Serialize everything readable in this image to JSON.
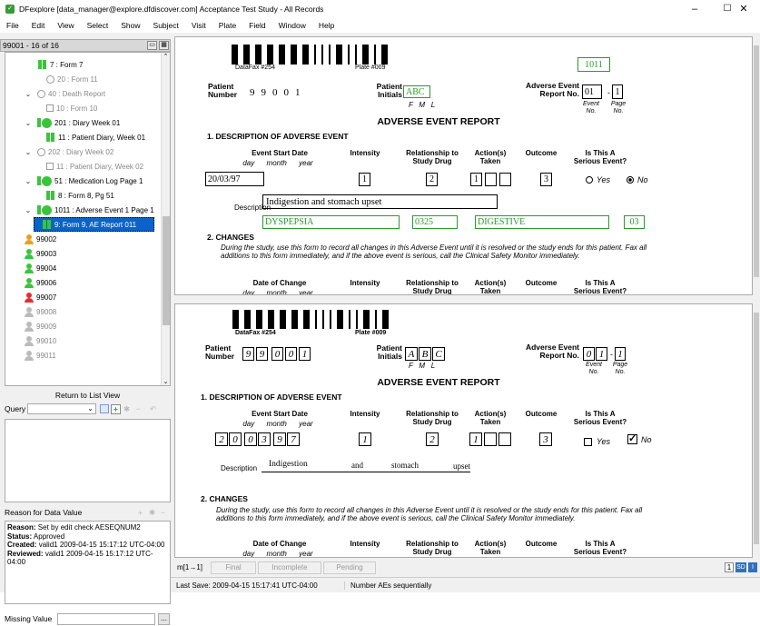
{
  "window": {
    "title": "DFexplore [data_manager@explore.dfdiscover.com] Acceptance Test Study - All Records",
    "minimize": "–",
    "maximize": "☐",
    "close": "✕"
  },
  "menu": [
    "File",
    "Edit",
    "View",
    "Select",
    "Show",
    "Subject",
    "Visit",
    "Plate",
    "Field",
    "Window",
    "Help"
  ],
  "left": {
    "header": "99001 - 16 of 16",
    "tree": [
      {
        "label": "7 : Form 7"
      },
      {
        "label": "20 : Form 11"
      },
      {
        "label": "40 : Death Report"
      },
      {
        "label": "10 : Form 10"
      },
      {
        "label": "201 : Diary Week 01"
      },
      {
        "label": "11 : Patient Diary, Week 01"
      },
      {
        "label": "202 : Diary Week 02"
      },
      {
        "label": "11 : Patient Diary, Week 02"
      },
      {
        "label": "51 : Medication Log Page 1"
      },
      {
        "label": "8 : Form 8, Pg 51"
      },
      {
        "label": "1011 : Adverse Event 1 Page 1"
      },
      {
        "label": "9: Form 9, AE Report 011"
      },
      {
        "label": "99002"
      },
      {
        "label": "99003"
      },
      {
        "label": "99004"
      },
      {
        "label": "99006"
      },
      {
        "label": "99007"
      },
      {
        "label": "99008"
      },
      {
        "label": "99009"
      },
      {
        "label": "99010"
      },
      {
        "label": "99011"
      }
    ],
    "return_label": "Return to List View",
    "query_label": "Query",
    "reason_header": "Reason for Data Value",
    "reason": {
      "reason_k": "Reason:",
      "reason_v": "Set by edit check AESEQNUM2",
      "status_k": "Status:",
      "status_v": "Approved",
      "created_k": "Created:",
      "created_v": "valid1 2009-04-15 15:17:12 UTC-04:00",
      "reviewed_k": "Reviewed:",
      "reviewed_v": "valid1 2009-04-15 15:17:12 UTC-04:00"
    },
    "missing_label": "Missing Value",
    "missing_btn": "..."
  },
  "form": {
    "datafax": "DataFax #254",
    "plate": "Plate #009",
    "plate_no": "1011",
    "patient_number_label": "Patient Number",
    "patient_number": [
      "9",
      "9",
      "0",
      "0",
      "1"
    ],
    "initials_label": "Patient Initials",
    "initials": "ABC",
    "initials_sub": "F   M   L",
    "ae_report_label": "Adverse Event Report No.",
    "event_no": "01",
    "page_no": "1",
    "event_sub": "Event No.",
    "page_sub": "Page No.",
    "heading": "ADVERSE EVENT REPORT",
    "sec1": "1. DESCRIPTION OF ADVERSE EVENT",
    "col_start": "Event Start Date",
    "col_start_sub": "day      month      year",
    "col_intensity": "Intensity",
    "col_rel": "Relationship to Study Drug",
    "col_action": "Action(s) Taken",
    "col_outcome": "Outcome",
    "col_serious": "Is This A Serious Event?",
    "start_date": "20/03/97",
    "intensity": "1",
    "relationship": "2",
    "action": "1",
    "outcome": "3",
    "yes": "Yes",
    "no": "No",
    "desc_label": "Description",
    "description": "Indigestion and stomach upset",
    "coded_term": "DYSPEPSIA",
    "code": "0325",
    "system": "DIGESTIVE",
    "system_code": "03",
    "sec2": "2. CHANGES",
    "changes_text": "During the study, use this form to record all changes in this Adverse Event until it is resolved or the study ends for this patient. Fax all additions to this form immediately, and if the above event is serious, call the Clinical Safety Monitor immediately.",
    "col_change": "Date of Change",
    "col_change_sub": "day      month      year"
  },
  "image": {
    "datafax": "DataFax #254",
    "plate": "Plate #009",
    "patient_number": [
      "9",
      "9",
      "0",
      "0",
      "1"
    ],
    "initials": [
      "A",
      "B",
      "C"
    ],
    "event_no": [
      "0",
      "1"
    ],
    "page_no": "1",
    "start_date": [
      "2",
      "0",
      "0",
      "3",
      "9",
      "7"
    ],
    "intensity": "1",
    "relationship": "2",
    "action": "1",
    "outcome": "3",
    "desc_words": [
      "Indigestion",
      "and",
      "stomach",
      "upset"
    ]
  },
  "status": {
    "record_nav": "m[1→1]",
    "tabs": [
      "Final",
      "Incomplete",
      "Pending"
    ],
    "right_badges": [
      "1",
      "SD",
      "I"
    ],
    "last_save": "Last Save: 2009-04-15 15:17:41 UTC-04:00",
    "message": "Number AEs sequentially"
  }
}
